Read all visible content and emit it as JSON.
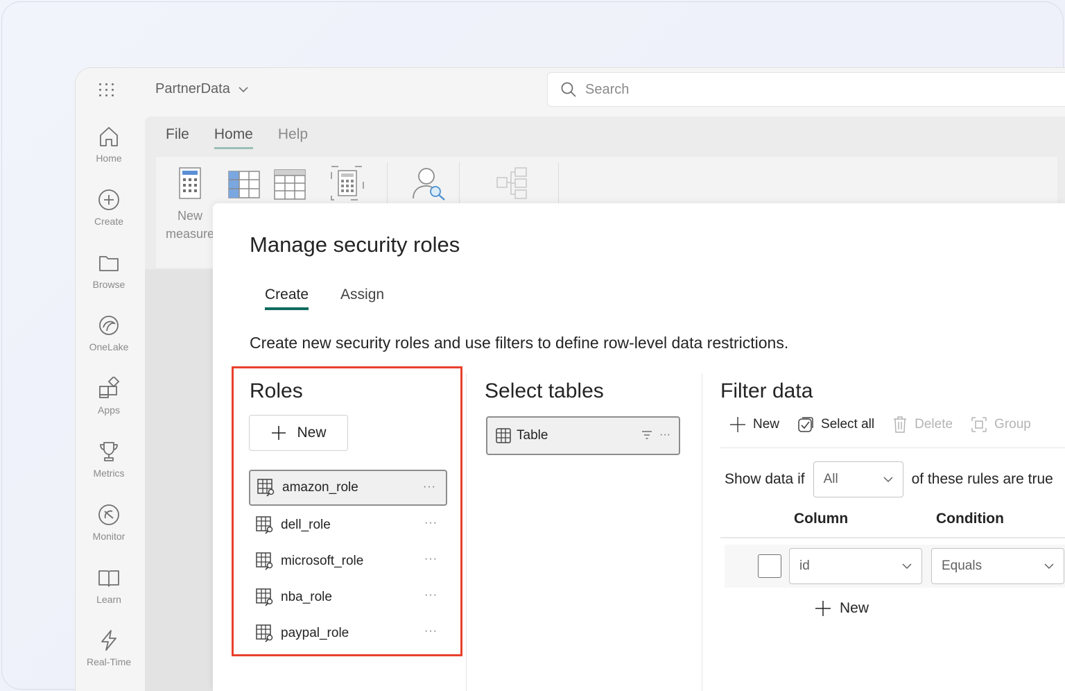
{
  "app": {
    "workspace_name": "PartnerData",
    "search_placeholder": "Search"
  },
  "nav": {
    "items": [
      {
        "label": "Home",
        "icon": "home-icon"
      },
      {
        "label": "Create",
        "icon": "create-icon"
      },
      {
        "label": "Browse",
        "icon": "folder-icon"
      },
      {
        "label": "OneLake",
        "icon": "onelake-icon"
      },
      {
        "label": "Apps",
        "icon": "apps-icon"
      },
      {
        "label": "Metrics",
        "icon": "trophy-icon"
      },
      {
        "label": "Monitor",
        "icon": "monitor-icon"
      },
      {
        "label": "Learn",
        "icon": "book-icon"
      },
      {
        "label": "Real-Time",
        "icon": "lightning-icon"
      }
    ]
  },
  "ribbon": {
    "tabs": [
      "File",
      "Home",
      "Help"
    ],
    "active_tab": "Home",
    "new_measure_label_line1": "New",
    "new_measure_label_line2": "measure"
  },
  "dialog": {
    "title": "Manage security roles",
    "tabs": [
      "Create",
      "Assign"
    ],
    "active_tab": "Create",
    "description": "Create new security roles and use filters to define row-level data restrictions.",
    "roles": {
      "title": "Roles",
      "new_label": "New",
      "items": [
        "amazon_role",
        "dell_role",
        "microsoft_role",
        "nba_role",
        "paypal_role"
      ],
      "selected": "amazon_role",
      "more_label": "···"
    },
    "tables": {
      "title": "Select tables",
      "items": [
        "Table"
      ],
      "more_label": "···"
    },
    "filter": {
      "title": "Filter data",
      "toolbar": {
        "new_label": "New",
        "select_all_label": "Select all",
        "delete_label": "Delete",
        "group_label": "Group"
      },
      "show_data_if": "Show data if",
      "match_value": "All",
      "rules_suffix": "of these rules are true",
      "column_header": "Column",
      "condition_header": "Condition",
      "rule": {
        "column": "id",
        "condition": "Equals"
      },
      "add_rule_label": "New"
    }
  },
  "colors": {
    "accent": "#0f6b5e",
    "highlight": "#e8412c"
  }
}
